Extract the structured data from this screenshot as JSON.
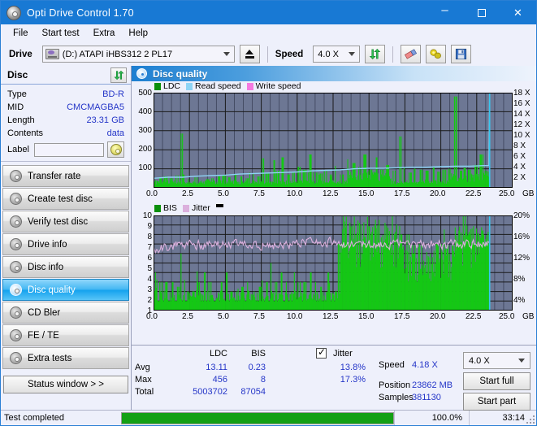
{
  "window": {
    "title": "Opti Drive Control 1.70",
    "icon": "disc-icon",
    "minimize": "–",
    "maximize": "□",
    "close": "✕"
  },
  "menu": [
    "File",
    "Start test",
    "Extra",
    "Help"
  ],
  "toolbar": {
    "drive_label": "Drive",
    "drive_value": "(D:)   ATAPI iHBS312  2 PL17",
    "eject_title": "Eject",
    "speed_label": "Speed",
    "speed_value": "4.0 X",
    "icons": [
      "refresh-icon",
      "eraser-icon",
      "bulb-icon",
      "save-icon"
    ]
  },
  "disc_panel": {
    "title": "Disc",
    "refresh_icon": "refresh-icon",
    "rows": [
      {
        "key": "Type",
        "value": "BD-R"
      },
      {
        "key": "MID",
        "value": "CMCMAGBA5"
      },
      {
        "key": "Length",
        "value": "23.31 GB"
      },
      {
        "key": "Contents",
        "value": "data"
      }
    ],
    "label_key": "Label",
    "label_value": "",
    "label_placeholder": "",
    "label_button_icon": "cd-icon"
  },
  "sidebar": {
    "items": [
      {
        "label": "Transfer rate",
        "selected": false
      },
      {
        "label": "Create test disc",
        "selected": false
      },
      {
        "label": "Verify test disc",
        "selected": false
      },
      {
        "label": "Drive info",
        "selected": false
      },
      {
        "label": "Disc info",
        "selected": false
      },
      {
        "label": "Disc quality",
        "selected": true
      },
      {
        "label": "CD Bler",
        "selected": false
      },
      {
        "label": "FE / TE",
        "selected": false
      },
      {
        "label": "Extra tests",
        "selected": false
      }
    ],
    "status_window_button": "Status window > >"
  },
  "main": {
    "header_title": "Disc quality",
    "header_icon": "disc-quality-icon"
  },
  "stats": {
    "col_headers": [
      "LDC",
      "BIS"
    ],
    "row_labels": [
      "Avg",
      "Max",
      "Total"
    ],
    "ldc": {
      "avg": "13.11",
      "max": "456",
      "total": "5003702"
    },
    "bis": {
      "avg": "0.23",
      "max": "8",
      "total": "87054"
    },
    "jitter": {
      "label": "Jitter",
      "checked": true,
      "avg": "13.8%",
      "max": "17.3%"
    },
    "speed_label": "Speed",
    "speed_value": "4.18 X",
    "position_label": "Position",
    "position_value": "23862 MB",
    "samples_label": "Samples",
    "samples_value": "381130",
    "speed_select": "4.0 X",
    "start_full_button": "Start full",
    "start_part_button": "Start part"
  },
  "statusbar": {
    "message": "Test completed",
    "progress_percent": "100.0%",
    "progress_value": 100,
    "elapsed": "33:14"
  },
  "colors": {
    "title_bar": "#1879d4",
    "plot_bg": "#6d7794",
    "ldc_green": "#14c814",
    "bis_green": "#14c814",
    "read_speed": "#8ed4f5",
    "write_speed": "#f57ae0",
    "jitter_pink": "#dbb0dd",
    "accent_blue": "#2536c8",
    "progress_green": "#14a014"
  },
  "chart_data": [
    {
      "type": "line",
      "name": "disc-quality-ldc-chart",
      "title": "",
      "xlabel": "GB",
      "ylabel": "LDC",
      "legend": [
        {
          "label": "LDC",
          "color": "#0a8f0a"
        },
        {
          "label": "Read speed",
          "color": "#8ed4f5"
        },
        {
          "label": "Write speed",
          "color": "#f57ae0"
        }
      ],
      "legend_position": "top-left",
      "grid": true,
      "xlim": [
        0,
        25
      ],
      "xticks": [
        "0.0",
        "2.5",
        "5.0",
        "7.5",
        "10.0",
        "12.5",
        "15.0",
        "17.5",
        "20.0",
        "22.5",
        "25.0"
      ],
      "ylim": [
        0,
        500
      ],
      "yticks": [
        "100",
        "200",
        "300",
        "400",
        "500"
      ],
      "y2lim": [
        0,
        18
      ],
      "y2ticks": [
        "2 X",
        "4 X",
        "6 X",
        "8 X",
        "10 X",
        "12 X",
        "14 X",
        "16 X",
        "18 X"
      ],
      "data_end_gb": 23.4,
      "series": [
        {
          "name": "LDC",
          "color": "#14c814",
          "type": "bar",
          "x": [
            0.1,
            0.4,
            0.8,
            1.2,
            1.6,
            1.95,
            2.1,
            2.5,
            2.9,
            3.3,
            3.7,
            4.1,
            4.5,
            4.9,
            5.3,
            5.7,
            6.1,
            6.5,
            6.9,
            7.3,
            7.6,
            7.9,
            8.3,
            8.6,
            8.9,
            9.3,
            9.7,
            10.1,
            10.5,
            10.9,
            11.3,
            11.6,
            11.9,
            12.3,
            12.7,
            13.1,
            13.5,
            13.9,
            14.3,
            14.7,
            15.1,
            15.5,
            15.9,
            16.3,
            16.7,
            17.1,
            17.4,
            17.8,
            18.2,
            18.6,
            19.0,
            19.4,
            19.8,
            20.2,
            20.6,
            21.0,
            21.4,
            21.6,
            22.0,
            22.4,
            22.8,
            23.1,
            23.3
          ],
          "y": [
            40,
            55,
            60,
            50,
            65,
            285,
            70,
            60,
            55,
            70,
            45,
            50,
            60,
            65,
            55,
            70,
            60,
            50,
            75,
            60,
            155,
            80,
            145,
            90,
            160,
            70,
            80,
            110,
            95,
            175,
            80,
            75,
            90,
            70,
            115,
            70,
            150,
            130,
            110,
            175,
            95,
            160,
            95,
            120,
            90,
            270,
            110,
            80,
            100,
            95,
            90,
            110,
            85,
            95,
            100,
            480,
            90,
            105,
            95,
            120,
            175,
            90,
            85
          ]
        },
        {
          "name": "Read speed",
          "color": "#8ed4f5",
          "type": "line",
          "x": [
            0.0,
            1.0,
            2.0,
            3.0,
            4.0,
            5.0,
            6.0,
            7.0,
            8.0,
            9.0,
            10.0,
            11.0,
            12.0,
            13.0,
            14.0,
            15.0,
            16.0,
            17.0,
            18.0,
            19.0,
            20.0,
            21.0,
            22.0,
            23.0,
            23.35,
            23.4
          ],
          "y": [
            1.8,
            2.0,
            2.0,
            2.2,
            2.3,
            2.4,
            2.6,
            2.7,
            2.8,
            2.9,
            3.0,
            3.2,
            3.3,
            3.4,
            3.6,
            3.7,
            3.7,
            3.8,
            3.9,
            3.9,
            4.0,
            4.1,
            4.1,
            4.2,
            4.2,
            18.0
          ]
        },
        {
          "name": "Write speed",
          "color": "#f57ae0",
          "type": "line",
          "x": [],
          "y": []
        }
      ]
    },
    {
      "type": "line",
      "name": "disc-quality-bis-jitter-chart",
      "title": "",
      "xlabel": "GB",
      "ylabel": "BIS",
      "legend": [
        {
          "label": "BIS",
          "color": "#0a8f0a"
        },
        {
          "label": "Jitter",
          "color": "#dbb0dd"
        }
      ],
      "legend_position": "top-left",
      "grid": true,
      "xlim": [
        0,
        25
      ],
      "xticks": [
        "0.0",
        "2.5",
        "5.0",
        "7.5",
        "10.0",
        "12.5",
        "15.0",
        "17.5",
        "20.0",
        "22.5",
        "25.0"
      ],
      "ylim": [
        0,
        10
      ],
      "yticks": [
        "1",
        "2",
        "3",
        "4",
        "5",
        "6",
        "7",
        "8",
        "9",
        "10"
      ],
      "y2lim": [
        0,
        20
      ],
      "y2ticks": [
        "4%",
        "8%",
        "12%",
        "16%",
        "20%"
      ],
      "data_end_gb": 23.4,
      "series": [
        {
          "name": "BIS",
          "color": "#14c814",
          "type": "bar",
          "baseline": 2,
          "x": [
            0.2,
            0.5,
            0.9,
            1.3,
            1.7,
            1.95,
            2.3,
            2.7,
            3.1,
            3.5,
            3.9,
            4.3,
            4.7,
            5.05,
            5.4,
            5.8,
            6.2,
            6.6,
            7.0,
            7.4,
            7.8,
            8.2,
            8.5,
            8.9,
            9.3,
            9.7,
            10.1,
            10.5,
            10.9,
            11.3,
            11.7,
            12.1,
            12.5,
            12.9,
            13.3,
            13.7,
            14.1,
            14.5,
            14.9,
            15.3,
            15.7,
            16.1,
            16.5,
            16.9,
            17.3,
            17.7,
            18.1,
            18.5,
            18.9,
            19.3,
            19.7,
            20.1,
            20.5,
            20.9,
            21.3,
            21.6,
            21.9,
            22.3,
            22.7,
            23.0,
            23.3
          ],
          "y": [
            4,
            3,
            3,
            3,
            2.5,
            6,
            2,
            2,
            3,
            4,
            3,
            2.5,
            3,
            4,
            2,
            2,
            2.5,
            3,
            2,
            2.5,
            3,
            5,
            3,
            4,
            3,
            4,
            3,
            3,
            4,
            3,
            2.5,
            4,
            4,
            7,
            8,
            7,
            8,
            6,
            7,
            7,
            6,
            6,
            7,
            7,
            8,
            8,
            6,
            7,
            7,
            6,
            7,
            7,
            6,
            7,
            8,
            12,
            7,
            7,
            6,
            8,
            7
          ]
        },
        {
          "name": "Jitter",
          "color": "#dbb0dd",
          "type": "line",
          "avg": 13.8,
          "max": 17.3,
          "x_range": [
            0,
            23.4
          ],
          "y_band": [
            12.2,
            15.5
          ],
          "y_center": 13.8
        }
      ]
    }
  ]
}
